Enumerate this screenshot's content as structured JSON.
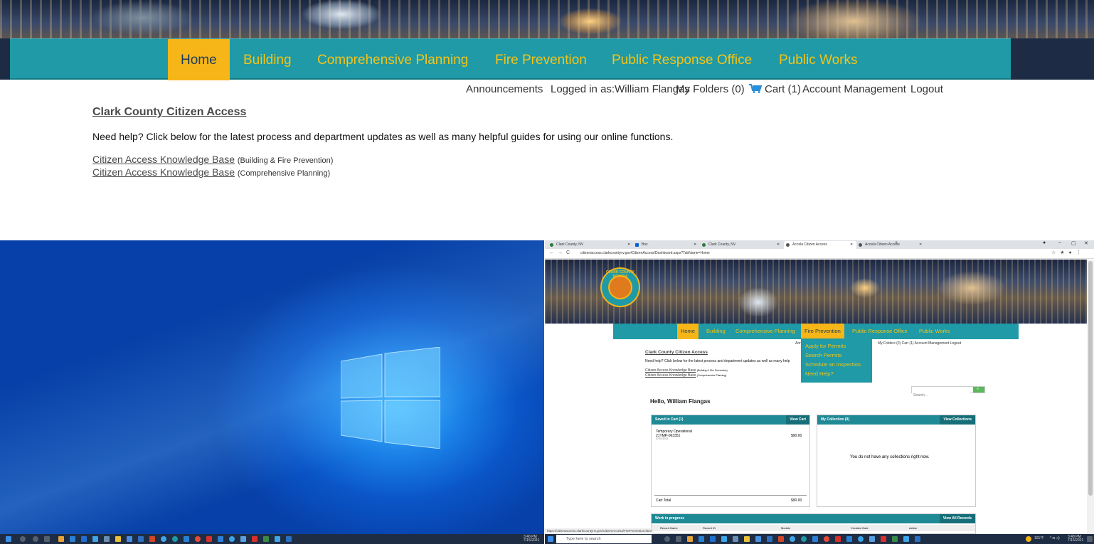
{
  "top": {
    "nav": [
      {
        "label": "Home",
        "active": true
      },
      {
        "label": "Building"
      },
      {
        "label": "Comprehensive Planning"
      },
      {
        "label": "Fire Prevention"
      },
      {
        "label": "Public Response Office"
      },
      {
        "label": "Public Works"
      }
    ],
    "utility": {
      "announcements": "Announcements",
      "logged_in": "Logged in as:William Flangas",
      "my_folders": "My Folders (0)",
      "cart": "Cart (1)",
      "account": "Account Management",
      "logout": "Logout"
    },
    "title": "Clark County Citizen Access",
    "need_help": "Need help? Click below for the latest process and department updates as well as many helpful guides for using our online functions.",
    "kb": [
      {
        "link": "Citizen Access Knowledge Base",
        "note": "(Building & Fire Prevention)"
      },
      {
        "link": "Citizen Access Knowledge Base",
        "note": "(Comprehensive Planning)"
      }
    ]
  },
  "browser": {
    "tabs": [
      {
        "label": "Clark County, NV"
      },
      {
        "label": "Box"
      },
      {
        "label": "Clark County, NV"
      },
      {
        "label": "Accela Citizen Access",
        "active": true
      },
      {
        "label": "Accela Citizen Access"
      }
    ],
    "url": "citizenaccess.clarkcountynv.gov/CitizenAccess/Dashboard.aspx?TabName=Home",
    "seal_text": "CLARK COUNTY NEVADA",
    "nav": [
      {
        "label": "Home",
        "active": true
      },
      {
        "label": "Building"
      },
      {
        "label": "Comprehensive Planning"
      },
      {
        "label": "Fire Prevention",
        "active": true
      },
      {
        "label": "Public Response Office"
      },
      {
        "label": "Public Works"
      }
    ],
    "dropdown": [
      "Apply for Permits",
      "Search Permits",
      "Schedule an Inspection",
      "Need Help?"
    ],
    "utility_right": "My Folders (0)   Cart (1)   Account Management   Logout",
    "utility_left": "Ann",
    "title": "Clark County Citizen Access",
    "need_help": "Need help? Click below for the latest process and department updates as well as many help",
    "kb": [
      {
        "link": "Citizen Access Knowledge Base",
        "note": "(Building & Fire Prevention)"
      },
      {
        "link": "Citizen Access Knowledge Base",
        "note": "(Comprehensive Planning)"
      }
    ],
    "search_placeholder": "Search...",
    "hello": "Hello, William Flangas",
    "cart_panel": {
      "title": "Saved in Cart (1)",
      "button": "View Cart",
      "item_name": "Temporary Operational",
      "item_id": "21TMP-063351",
      "item_date": "07/01/2021",
      "item_price": "$90.00",
      "total_label": "Cart Total",
      "total_value": "$90.00"
    },
    "collection_panel": {
      "title": "My Collection (0)",
      "button": "View Collections",
      "empty": "You do not have any collections right now."
    },
    "work_panel": {
      "title": "Work in progress",
      "button": "View All Records",
      "columns": [
        "Record Name",
        "Record ID",
        "Module",
        "Creation Date",
        "Action"
      ]
    },
    "status_url": "https://citizenaccess.clarkcountynv.gov/CitizenAccess/FirePrevention.html"
  },
  "taskbar_left": {
    "time": "3:46 PM",
    "date": "7/15/2021"
  },
  "taskbar_right": {
    "search_placeholder": "Type here to search",
    "weather": "101°F",
    "time": "3:48 PM",
    "date": "7/15/2021"
  },
  "colors": {
    "nav_teal": "#1f9aa6",
    "nav_gold": "#f4c318",
    "active_bg": "#f6b618"
  }
}
